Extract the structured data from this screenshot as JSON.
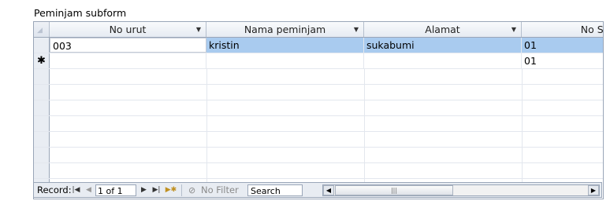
{
  "title": "Peminjam subform",
  "columns": [
    {
      "label": "No urut",
      "arrow": "▼"
    },
    {
      "label": "Nama peminjam",
      "arrow": "▼"
    },
    {
      "label": "Alamat",
      "arrow": "▼"
    },
    {
      "label": "No Seri",
      "arrow": ""
    }
  ],
  "rows": [
    {
      "selector": "",
      "cells": [
        "003",
        "kristin",
        "sukabumi",
        "01"
      ]
    },
    {
      "selector": "✱",
      "cells": [
        "",
        "",
        "",
        "01"
      ]
    }
  ],
  "corner_glyph": "◢",
  "nav": {
    "record_label": "Record:",
    "first": "|◀",
    "prev": "◀",
    "position": "1 of 1",
    "next": "▶",
    "last": "▶|",
    "new": "▶✱",
    "no_filter": "No Filter",
    "filter_icon": "⊘",
    "search_placeholder": "Search",
    "scroll_left": "◀",
    "scroll_thumb": "|||",
    "scroll_right": "▶"
  },
  "colors": {
    "selected_row": "#a9cbef",
    "border": "#9aa6b8"
  }
}
